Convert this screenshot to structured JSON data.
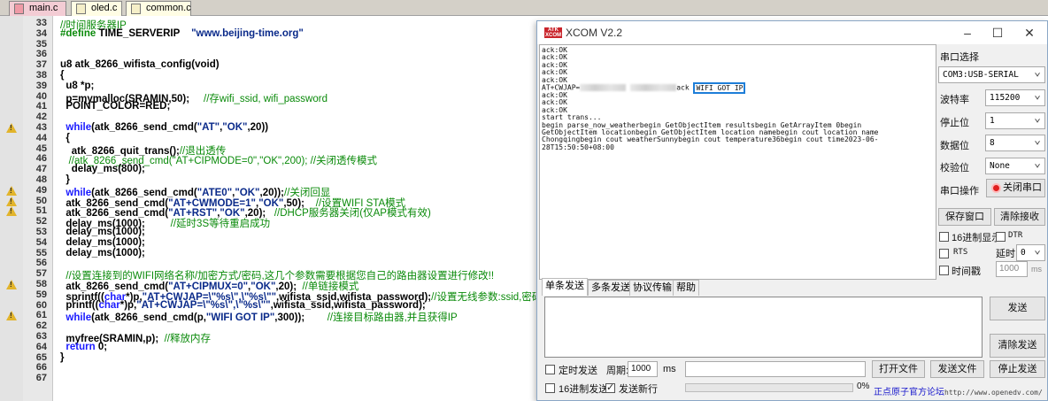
{
  "editor": {
    "tabs": [
      {
        "label": "main.c",
        "active": true
      },
      {
        "label": "oled.c",
        "active": false
      },
      {
        "label": "common.c",
        "active": false
      }
    ],
    "lines": [
      {
        "n": "33",
        "warn": false,
        "html": "<span class=\"cm\">//时间服务器IP</span>"
      },
      {
        "n": "34",
        "warn": false,
        "html": "<span class=\"pp\">#define</span> TIME_SERVERIP&nbsp;&nbsp;&nbsp;&nbsp;<span class=\"st\">\"www.beijing-time.org\"</span>"
      },
      {
        "n": "35",
        "warn": false,
        "html": ""
      },
      {
        "n": "36",
        "warn": false,
        "html": ""
      },
      {
        "n": "37",
        "warn": false,
        "html": "u8 atk_8266_wifista_config(void)"
      },
      {
        "n": "38",
        "warn": false,
        "html": "{"
      },
      {
        "n": "39",
        "warn": false,
        "html": "&nbsp;&nbsp;u8 *p;"
      },
      {
        "n": "40",
        "warn": false,
        "html": "&nbsp;&nbsp;p=mymalloc(SRAMIN,50);&nbsp;&nbsp;&nbsp;&nbsp;&nbsp;<span class=\"cm\">//存wifi_ssid, wifi_password</span>"
      },
      {
        "n": "41",
        "warn": false,
        "html": "&nbsp;&nbsp;POINT_COLOR=RED;"
      },
      {
        "n": "42",
        "warn": false,
        "html": ""
      },
      {
        "n": "43",
        "warn": true,
        "html": "&nbsp;&nbsp;<span class=\"kw\">while</span>(atk_8266_send_cmd(<span class=\"st\">\"AT\"</span>,<span class=\"st\">\"OK\"</span>,20))"
      },
      {
        "n": "44",
        "warn": false,
        "html": "&nbsp;&nbsp;{"
      },
      {
        "n": "45",
        "warn": false,
        "html": "&nbsp;&nbsp;&nbsp;&nbsp;atk_8266_quit_trans();<span class=\"cm\">//退出透传</span>"
      },
      {
        "n": "46",
        "warn": false,
        "html": "&nbsp;&nbsp;&nbsp;<span class=\"cm\">//atk_8266_send_cmd(\"AT+CIPMODE=0\",\"OK\",200); //关闭透传模式</span>"
      },
      {
        "n": "47",
        "warn": false,
        "html": "&nbsp;&nbsp;&nbsp;&nbsp;delay_ms(800);"
      },
      {
        "n": "48",
        "warn": false,
        "html": "&nbsp;&nbsp;}"
      },
      {
        "n": "49",
        "warn": true,
        "html": "&nbsp;&nbsp;<span class=\"kw\">while</span>(atk_8266_send_cmd(<span class=\"st\">\"ATE0\"</span>,<span class=\"st\">\"OK\"</span>,20));<span class=\"cm\">//关闭回显</span>"
      },
      {
        "n": "50",
        "warn": true,
        "html": "&nbsp;&nbsp;atk_8266_send_cmd(<span class=\"st\">\"AT+CWMODE=1\"</span>,<span class=\"st\">\"OK\"</span>,50);&nbsp;&nbsp;&nbsp;&nbsp;<span class=\"cm\">//设置WIFI STA模式</span>"
      },
      {
        "n": "51",
        "warn": true,
        "html": "&nbsp;&nbsp;atk_8266_send_cmd(<span class=\"st\">\"AT+RST\"</span>,<span class=\"st\">\"OK\"</span>,20);&nbsp;&nbsp;&nbsp;<span class=\"cm\">//DHCP服务器关闭(仅AP模式有效)</span>"
      },
      {
        "n": "52",
        "warn": false,
        "html": "&nbsp;&nbsp;delay_ms(1000);&nbsp;&nbsp;&nbsp;&nbsp;&nbsp;&nbsp;&nbsp;&nbsp;&nbsp;<span class=\"cm\">//延时3S等待重启成功</span>"
      },
      {
        "n": "53",
        "warn": false,
        "html": "&nbsp;&nbsp;delay_ms(1000);"
      },
      {
        "n": "54",
        "warn": false,
        "html": "&nbsp;&nbsp;delay_ms(1000);"
      },
      {
        "n": "55",
        "warn": false,
        "html": "&nbsp;&nbsp;delay_ms(1000);"
      },
      {
        "n": "56",
        "warn": false,
        "html": ""
      },
      {
        "n": "57",
        "warn": false,
        "html": "&nbsp;&nbsp;<span class=\"cm\">//设置连接到的WIFI网络名称/加密方式/密码,这几个参数需要根据您自己的路由器设置进行修改!!</span>"
      },
      {
        "n": "58",
        "warn": true,
        "html": "&nbsp;&nbsp;atk_8266_send_cmd(<span class=\"st\">\"AT+CIPMUX=0\"</span>,<span class=\"st\">\"OK\"</span>,20);&nbsp;&nbsp;<span class=\"cm\">//单链接模式</span>"
      },
      {
        "n": "59",
        "warn": false,
        "html": "&nbsp;&nbsp;sprintf((<span class=\"kw\">char</span>*)p,<span class=\"st\">\"AT+CWJAP=\\\"%s\\\",\\\"%s\\\"\"</span>,wifista_ssid,wifista_password);<span class=\"cm\">//设置无线参数:ssid,密码</span>"
      },
      {
        "n": "60",
        "warn": false,
        "html": "&nbsp;&nbsp;printf((<span class=\"kw\">char</span>*)p,<span class=\"st\">\"AT+CWJAP=\\\"%s\\\",\\\"%s\\\"\"</span>,wifista_ssid,wifista_password);"
      },
      {
        "n": "61",
        "warn": true,
        "html": "&nbsp;&nbsp;<span class=\"kw\">while</span>(atk_8266_send_cmd(p,<span class=\"st\">\"WIFI GOT IP\"</span>,300));&nbsp;&nbsp;&nbsp;&nbsp;&nbsp;&nbsp;&nbsp;&nbsp;<span class=\"cm\">//连接目标路由器,并且获得IP</span>"
      },
      {
        "n": "62",
        "warn": false,
        "html": ""
      },
      {
        "n": "63",
        "warn": false,
        "html": "&nbsp;&nbsp;myfree(SRAMIN,p);&nbsp;&nbsp;<span class=\"cm\">//释放内存</span>"
      },
      {
        "n": "64",
        "warn": false,
        "html": "&nbsp;&nbsp;<span class=\"kw\">return</span> 0;"
      },
      {
        "n": "65",
        "warn": false,
        "html": "}"
      },
      {
        "n": "66",
        "warn": false,
        "html": ""
      },
      {
        "n": "67",
        "warn": false,
        "html": ""
      }
    ]
  },
  "xcom": {
    "title": "XCOM V2.2",
    "logo_text": "ATK\nXCOM",
    "receive_lines_before": "ack:OK\nack:OK\nack:OK\nack:OK\nack:OK\n",
    "cwjap_prefix": "AT+CWJAP=",
    "cwjap_mid": "ack",
    "got_ip": "WIFI GOT IP",
    "receive_lines_after": "\nack:OK\nack:OK\nack:OK\nstart trans...\nbegin parse_now_weatherbegin GetObjectItem resultsbegin GetArrayItem 0begin\nGetObjectItem locationbegin GetObjectItem location namebegin cout location name\nChongqingbegin cout weatherSunnybegin cout temperature36begin cout time2023-06-\n28T15:50:50+08:00",
    "serial_select_label": "串口选择",
    "port_value": "COM3:USB-SERIAL",
    "baud_label": "波特率",
    "baud_value": "115200",
    "stopbit_label": "停止位",
    "stopbit_value": "1",
    "databit_label": "数据位",
    "databit_value": "8",
    "parity_label": "校验位",
    "parity_value": "None",
    "port_op_label": "串口操作",
    "close_port_btn": "关闭串口",
    "save_window_btn": "保存窗口",
    "clear_recv_btn": "清除接收",
    "hex_display": "16进制显示",
    "dtr": "DTR",
    "rts": "RTS",
    "delay_label": "延时",
    "delay_value": "0",
    "timestamp": "时间戳",
    "timestamp_value": "1000",
    "ms": "ms",
    "send_tabs": [
      "单条发送",
      "多条发送",
      "协议传输",
      "帮助"
    ],
    "send_btn": "发送",
    "clear_send_btn": "清除发送",
    "timed_send": "定时发送",
    "period_label": "周期:",
    "period_value": "1000",
    "period_unit": "ms",
    "open_file_btn": "打开文件",
    "send_file_btn": "发送文件",
    "stop_send_btn": "停止发送",
    "hex_send": "16进制发送",
    "send_newline": "发送新行",
    "progress_pct": "0%",
    "forum_link": "正点原子官方论坛",
    "forum_url": "http://www.openedv.com/"
  },
  "colors": {
    "highlight": "#1e7ed8",
    "warning": "#e2b42b",
    "comment": "#0a8a0a",
    "keyword": "#1a1aff",
    "close_port_led": "#e02020"
  }
}
